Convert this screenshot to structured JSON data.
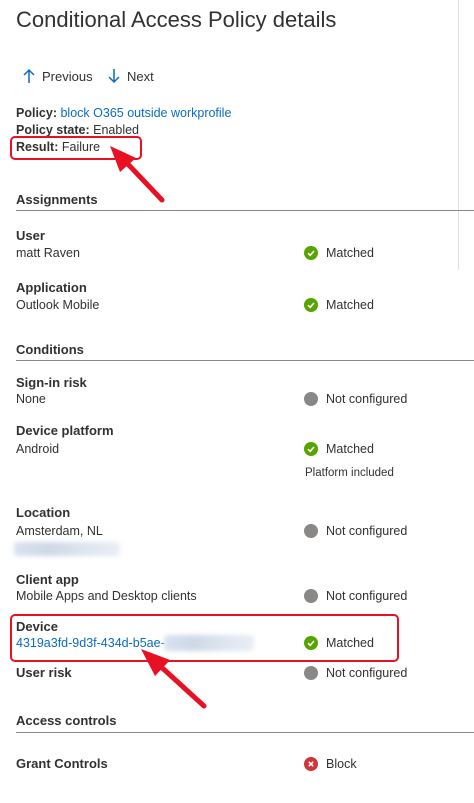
{
  "title": "Conditional Access Policy details",
  "nav": {
    "previous_label": "Previous",
    "next_label": "Next"
  },
  "summary": {
    "policy_label": "Policy:",
    "policy_value": "block O365 outside workprofile",
    "state_label": "Policy state:",
    "state_value": "Enabled",
    "result_label": "Result:",
    "result_value": "Failure"
  },
  "assignments": {
    "heading": "Assignments",
    "items": [
      {
        "title": "User",
        "value": "matt Raven",
        "status": "Matched",
        "status_icon": "check-icon"
      },
      {
        "title": "Application",
        "value": "Outlook Mobile",
        "status": "Matched",
        "status_icon": "check-icon"
      }
    ]
  },
  "conditions": {
    "heading": "Conditions",
    "items": [
      {
        "title": "Sign-in risk",
        "value": "None",
        "status": "Not configured",
        "status_icon": "dot-icon"
      },
      {
        "title": "Device platform",
        "value": "Android",
        "status": "Matched",
        "status_icon": "check-icon",
        "note": "Platform included"
      },
      {
        "title": "Location",
        "value": "Amsterdam, NL",
        "status": "Not configured",
        "status_icon": "dot-icon"
      },
      {
        "title": "Client app",
        "value": "Mobile Apps and Desktop clients",
        "status": "Not configured",
        "status_icon": "dot-icon"
      },
      {
        "title": "Device",
        "value": "4319a3fd-9d3f-434d-b5ae-",
        "status": "Matched",
        "status_icon": "check-icon"
      },
      {
        "title": "User risk",
        "value": "",
        "status": "Not configured",
        "status_icon": "dot-icon"
      }
    ]
  },
  "access_controls": {
    "heading": "Access controls",
    "items": [
      {
        "title": "Grant Controls",
        "status": "Block",
        "status_icon": "block-icon"
      }
    ]
  },
  "colors": {
    "link": "#0a6cc2",
    "matched": "#57a300",
    "not_configured": "#8a8886",
    "block": "#d13438",
    "annotation": "#e81123"
  }
}
